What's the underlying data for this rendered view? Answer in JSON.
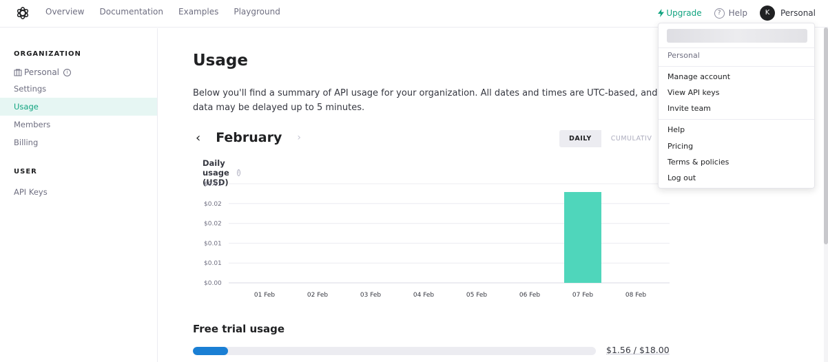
{
  "nav": {
    "logo_icon": "openai-logo-icon",
    "links": [
      "Overview",
      "Documentation",
      "Examples",
      "Playground"
    ],
    "upgrade_label": "Upgrade",
    "help_label": "Help",
    "avatar_initial": "K",
    "account_label": "Personal"
  },
  "sidebar": {
    "org_heading": "ORGANIZATION",
    "org_name": "Personal",
    "org_items": [
      "Settings",
      "Usage",
      "Members",
      "Billing"
    ],
    "active_item": "Usage",
    "user_heading": "USER",
    "user_items": [
      "API Keys"
    ]
  },
  "main": {
    "title": "Usage",
    "description": "Below you'll find a summary of API usage for your organization. All dates and times are UTC-based, and data may be delayed up to 5 minutes.",
    "month": "February",
    "prev_arrow": "‹",
    "next_arrow": "›",
    "toggle": {
      "daily": "DAILY",
      "cumulative": "CUMULATIV"
    },
    "chart_title": "Daily usage (USD)",
    "trial_title": "Free trial usage",
    "trial_amount": "$1.56 / $18.00",
    "trial_progress": 0.0867
  },
  "chart_data": {
    "type": "bar",
    "title": "Daily usage (USD)",
    "categories": [
      "01 Feb",
      "02 Feb",
      "03 Feb",
      "04 Feb",
      "05 Feb",
      "06 Feb",
      "07 Feb",
      "08 Feb"
    ],
    "values": [
      0,
      0,
      0,
      0,
      0,
      0,
      0.0275,
      0
    ],
    "y_tick_labels": [
      "$0.00",
      "$0.01",
      "$0.01",
      "$0.02",
      "$0.02",
      "$0.03"
    ],
    "ylim": [
      0,
      0.03
    ],
    "grid": true,
    "bar_color": "#4fd6bb"
  },
  "dropdown": {
    "section1": [
      "Personal"
    ],
    "section2": [
      "Manage account",
      "View API keys",
      "Invite team"
    ],
    "section3": [
      "Help",
      "Pricing",
      "Terms & policies",
      "Log out"
    ]
  },
  "colors": {
    "accent": "#10a37f",
    "progress": "#1a7fd4"
  }
}
